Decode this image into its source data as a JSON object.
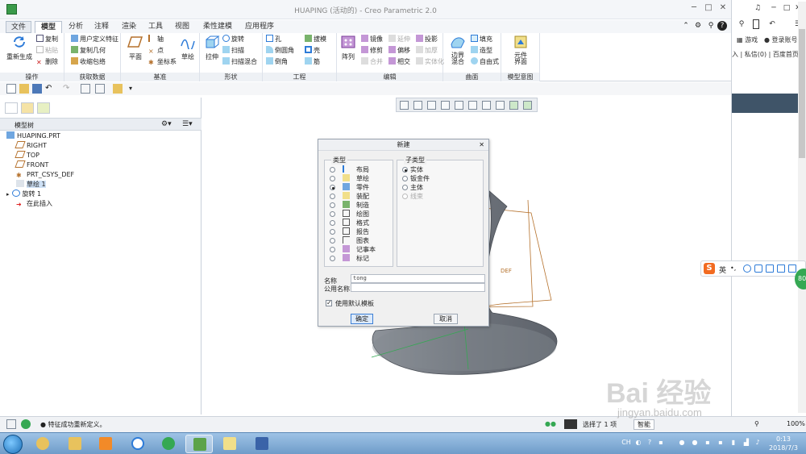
{
  "app": {
    "title": "HUAPING (活动的) - Creo Parametric 2.0"
  },
  "tabs": [
    "文件",
    "模型",
    "分析",
    "注释",
    "渲染",
    "工具",
    "视图",
    "柔性建模",
    "应用程序"
  ],
  "ribbon": {
    "operations": {
      "name": "操作",
      "regen": "重新生成",
      "copy": "复制",
      "paste": "粘贴",
      "delete": "删除"
    },
    "getdata": {
      "name": "获取数据",
      "udf": "用户定义特征",
      "copygeom": "复制几何",
      "shrinkwrap": "收缩包络"
    },
    "datum": {
      "name": "基准",
      "plane": "平面",
      "axis": "轴",
      "point": "点",
      "csys": "坐标系",
      "sketch": "草绘"
    },
    "shapes": {
      "name": "形状",
      "extrude": "拉伸",
      "revolve": "旋转",
      "sweep": "扫描",
      "sweptblend": "扫描混合"
    },
    "engineering": {
      "name": "工程",
      "hole": "孔",
      "round": "倒圆角",
      "chamfer": "倒角",
      "draft": "拔模",
      "shell": "壳",
      "rib": "筋"
    },
    "editing": {
      "name": "编辑",
      "pattern": "阵列",
      "mirror": "镜像",
      "trim": "修剪",
      "merge": "合并",
      "extend": "延伸",
      "offset": "偏移",
      "intersect": "相交",
      "project": "投影",
      "thicken": "加厚",
      "solidify": "实体化"
    },
    "surfaces": {
      "name": "曲面",
      "boundary": "边界\n混合",
      "fill": "填充",
      "style": "造型",
      "freestyle": "自由式"
    },
    "modelintent": {
      "name": "模型意图",
      "component": "元件\n界面"
    }
  },
  "tree": {
    "title": "模型树",
    "nodes": [
      {
        "label": "HUAPING.PRT"
      },
      {
        "label": "RIGHT"
      },
      {
        "label": "TOP"
      },
      {
        "label": "FRONT"
      },
      {
        "label": "PRT_CSYS_DEF"
      },
      {
        "label": "草绘 1"
      },
      {
        "label": "旋转 1"
      },
      {
        "label": "在此插入"
      }
    ]
  },
  "graphics": {
    "label_def": "DEF"
  },
  "dialog": {
    "title": "新建",
    "type_legend": "类型",
    "subtype_legend": "子类型",
    "types": [
      "布局",
      "草绘",
      "零件",
      "装配",
      "制造",
      "绘图",
      "格式",
      "报告",
      "图表",
      "记事本",
      "标记"
    ],
    "selected_type": "零件",
    "subtypes": [
      "实体",
      "钣金件",
      "主体",
      "线束"
    ],
    "selected_subtype": "实体",
    "name_label": "名称",
    "name_value": "tong",
    "common_name_label": "公用名称",
    "common_name_value": "",
    "use_template": "使用默认模板",
    "ok": "确定",
    "cancel": "取消"
  },
  "status": {
    "message": "● 特征成功重新定义。",
    "selected": "选择了 1 项",
    "filter": "智能",
    "zoom": "100%"
  },
  "browser": {
    "games": "游戏",
    "login": "登录账号",
    "links": "入 | 私信(0) | 百度首页"
  },
  "ime": {
    "logo": "S",
    "lang": "英"
  },
  "taskbar": {
    "lang": "CH",
    "time": "0:13",
    "date": "2018/7/3"
  },
  "watermark": {
    "main": "Bai 经验",
    "sub": "jingyan.baidu.com"
  },
  "colors": {
    "accent": "#2d7bd8",
    "ribbon_bg": "#f4f6f9",
    "datum_orange": "#b5712c",
    "model_gray": "#7b8089"
  }
}
